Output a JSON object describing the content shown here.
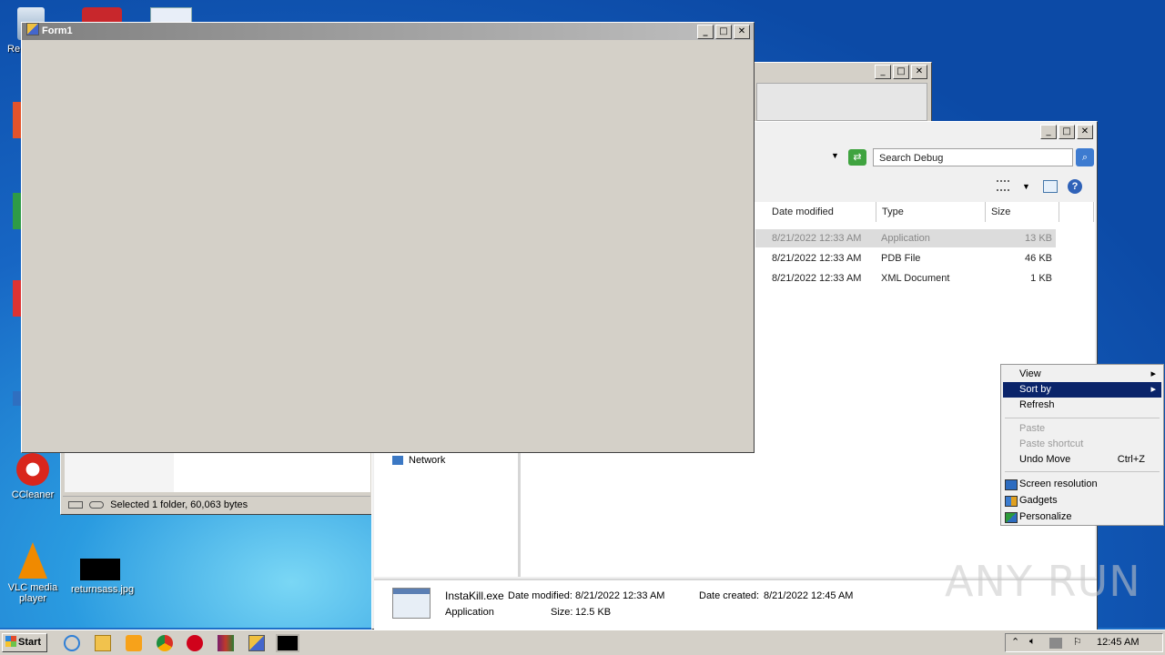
{
  "desktop": {
    "icons": [
      {
        "label": "Re"
      },
      {
        "label": "CCleaner"
      },
      {
        "label": "VLC media player"
      },
      {
        "label": "returnsass.jpg"
      }
    ]
  },
  "form1": {
    "title": "Form1"
  },
  "explorer": {
    "search_placeholder": "Search Debug",
    "columns": [
      "Date modified",
      "Type",
      "Size"
    ],
    "rows": [
      {
        "date": "8/21/2022 12:33 AM",
        "type": "Application",
        "size": "13 KB"
      },
      {
        "date": "8/21/2022 12:33 AM",
        "type": "PDB File",
        "size": "46 KB"
      },
      {
        "date": "8/21/2022 12:33 AM",
        "type": "XML Document",
        "size": "1 KB"
      }
    ],
    "nav_network": "Network",
    "details": {
      "filename": "InstaKill.exe",
      "date_modified_label": "Date modified:",
      "date_modified": "8/21/2022 12:33 AM",
      "date_created_label": "Date created:",
      "date_created": "8/21/2022 12:45 AM",
      "type": "Application",
      "size_label": "Size:",
      "size": "12.5 KB"
    }
  },
  "left_explorer": {
    "status": "Selected 1 folder, 60,063 bytes"
  },
  "context_menu": {
    "view": "View",
    "sort_by": "Sort by",
    "refresh": "Refresh",
    "paste": "Paste",
    "paste_shortcut": "Paste shortcut",
    "undo_move": "Undo Move",
    "undo_shortcut": "Ctrl+Z",
    "screen_resolution": "Screen resolution",
    "gadgets": "Gadgets",
    "personalize": "Personalize"
  },
  "taskbar": {
    "start": "Start",
    "clock": "12:45 AM"
  },
  "watermark": "ANY RUN"
}
